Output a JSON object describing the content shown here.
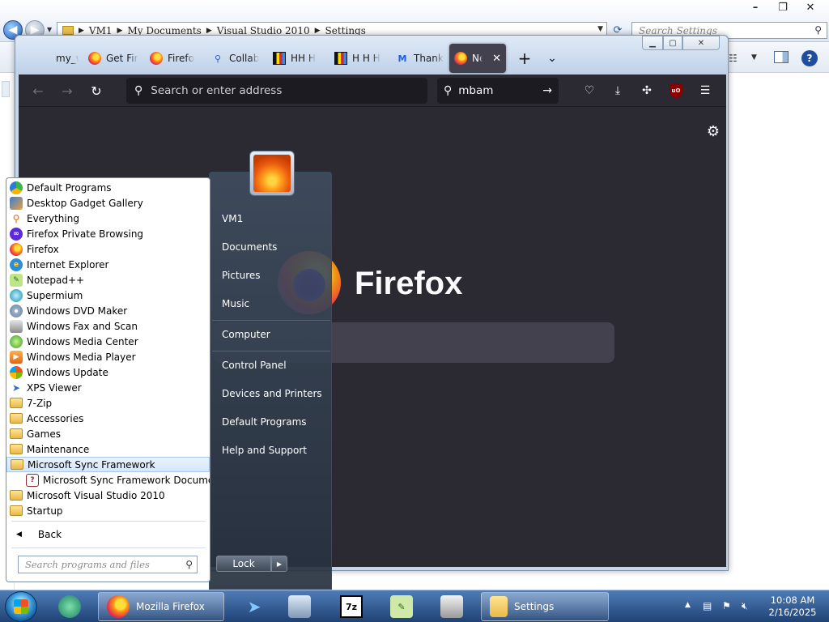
{
  "explorer": {
    "breadcrumb": [
      "VM1",
      "My Documents",
      "Visual Studio 2010",
      "Settings"
    ],
    "search_placeholder": "Search Settings",
    "winbtns": {
      "minimize": "–",
      "maximize": "❐",
      "close": "✕"
    }
  },
  "firefox": {
    "tabs": [
      {
        "label": "my_wallpa",
        "icon": "blank-icon"
      },
      {
        "label": "Get Fir",
        "icon": "firefox-icon"
      },
      {
        "label": "Firefo",
        "icon": "firefox-icon"
      },
      {
        "label": "Collab",
        "icon": "search-icon"
      },
      {
        "label": "HH H",
        "icon": "hh-icon"
      },
      {
        "label": "H H H",
        "icon": "hh-icon"
      },
      {
        "label": "Thank",
        "icon": "malwarebytes-icon"
      },
      {
        "label": "Ne",
        "icon": "firefox-icon",
        "active": true
      }
    ],
    "url_placeholder": "Search or enter address",
    "search_value": "mbam",
    "brand": "Firefox"
  },
  "start_menu": {
    "user_name": "VM1",
    "right_items": [
      "VM1",
      "Documents",
      "Pictures",
      "Music",
      "Computer",
      "Control Panel",
      "Devices and Printers",
      "Default Programs",
      "Help and Support"
    ],
    "programs": [
      {
        "label": "Default Programs",
        "icon": "default-programs-icon"
      },
      {
        "label": "Desktop Gadget Gallery",
        "icon": "gadget-icon"
      },
      {
        "label": "Everything",
        "icon": "magnifier-icon"
      },
      {
        "label": "Firefox Private Browsing",
        "icon": "private-mask-icon"
      },
      {
        "label": "Firefox",
        "icon": "firefox-icon"
      },
      {
        "label": "Internet Explorer",
        "icon": "ie-icon"
      },
      {
        "label": "Notepad++",
        "icon": "notepadpp-icon"
      },
      {
        "label": "Supermium",
        "icon": "supermium-icon"
      },
      {
        "label": "Windows DVD Maker",
        "icon": "dvd-icon"
      },
      {
        "label": "Windows Fax and Scan",
        "icon": "fax-icon"
      },
      {
        "label": "Windows Media Center",
        "icon": "media-center-icon"
      },
      {
        "label": "Windows Media Player",
        "icon": "media-player-icon"
      },
      {
        "label": "Windows Update",
        "icon": "windows-update-icon"
      },
      {
        "label": "XPS Viewer",
        "icon": "xps-icon"
      },
      {
        "label": "7-Zip",
        "icon": "folder-icon"
      },
      {
        "label": "Accessories",
        "icon": "folder-icon"
      },
      {
        "label": "Games",
        "icon": "folder-icon"
      },
      {
        "label": "Maintenance",
        "icon": "folder-icon"
      },
      {
        "label": "Microsoft Sync Framework",
        "icon": "folder-icon",
        "selected": true
      },
      {
        "label": "Microsoft Sync Framework Documentation",
        "icon": "help-doc-icon",
        "sub": true
      },
      {
        "label": "Microsoft Visual Studio 2010",
        "icon": "folder-icon"
      },
      {
        "label": "Startup",
        "icon": "folder-icon"
      }
    ],
    "back_label": "Back",
    "search_placeholder": "Search programs and files",
    "lock_label": "Lock"
  },
  "taskbar": {
    "firefox_label": "Mozilla Firefox",
    "settings_label": "Settings",
    "seven_zip_label": "7z",
    "clock_time": "10:08 AM",
    "clock_date": "2/16/2025"
  }
}
